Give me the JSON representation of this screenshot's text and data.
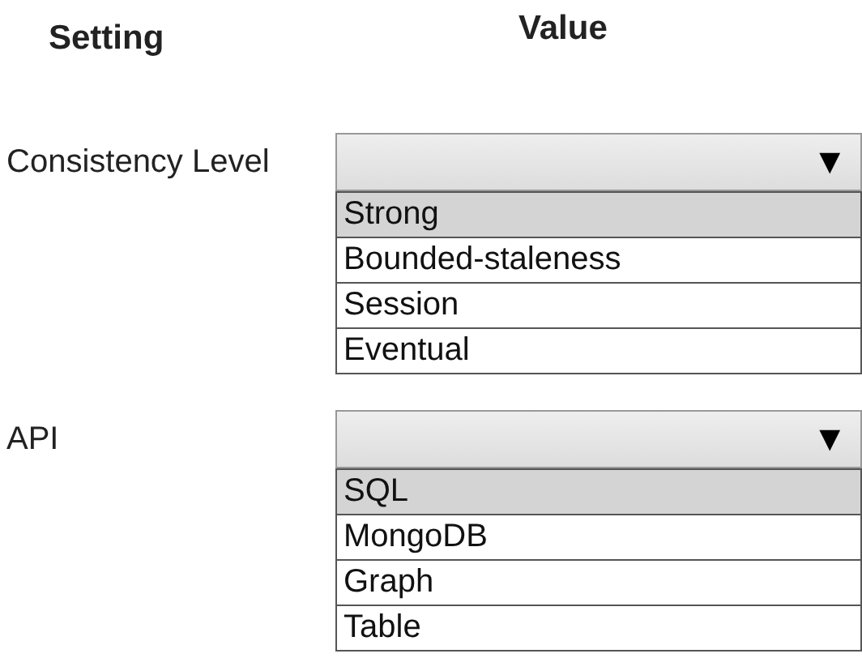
{
  "headers": {
    "setting": "Setting",
    "value": "Value"
  },
  "settings": [
    {
      "label": "Consistency Level",
      "caret": "▼",
      "options": [
        {
          "label": "Strong",
          "selected": true
        },
        {
          "label": "Bounded-staleness",
          "selected": false
        },
        {
          "label": "Session",
          "selected": false
        },
        {
          "label": "Eventual",
          "selected": false
        }
      ]
    },
    {
      "label": "API",
      "caret": "▼",
      "options": [
        {
          "label": "SQL",
          "selected": true
        },
        {
          "label": "MongoDB",
          "selected": false
        },
        {
          "label": "Graph",
          "selected": false
        },
        {
          "label": "Table",
          "selected": false
        }
      ]
    }
  ]
}
